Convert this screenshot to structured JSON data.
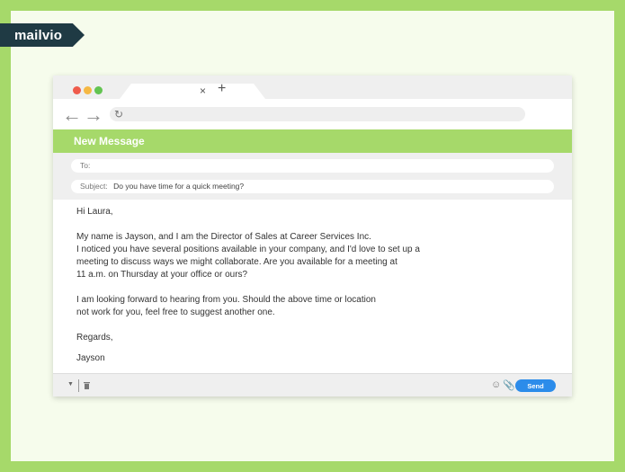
{
  "logo": {
    "text": "mailvio"
  },
  "browser": {
    "tab_close": "×",
    "tab_new": "+",
    "back_glyph": "←",
    "forward_glyph": "→",
    "reload_glyph": "↻"
  },
  "compose": {
    "title": "New Message",
    "to_label": "To:",
    "subject_label": "Subject:",
    "subject_value": "Do you have time for a quick meeting?"
  },
  "body": {
    "greeting": "Hi Laura,",
    "para1": [
      "My name is Jayson, and I am the Director of Sales at Career Services Inc.",
      "I noticed you have several positions available in your company, and I'd love to set up a",
      "meeting to discuss ways we might collaborate. Are you available for a meeting at",
      "11 a.m. on Thursday at your office or ours?"
    ],
    "para2": [
      "I am looking forward to hearing from you. Should the above time or location",
      "not work for you, feel free to suggest another one."
    ],
    "regards": "Regards,",
    "signature": "Jayson"
  },
  "footer": {
    "more_glyph": "▼",
    "emoji_glyph": "☺",
    "clip_glyph": "📎",
    "send_label": "Send"
  },
  "colors": {
    "accent_green": "#a6d96a",
    "send_blue": "#2c8cea",
    "logo_bg": "#1f3a44",
    "dot_red": "#ef5b4c",
    "dot_yellow": "#f5b844",
    "dot_green": "#63c451"
  }
}
